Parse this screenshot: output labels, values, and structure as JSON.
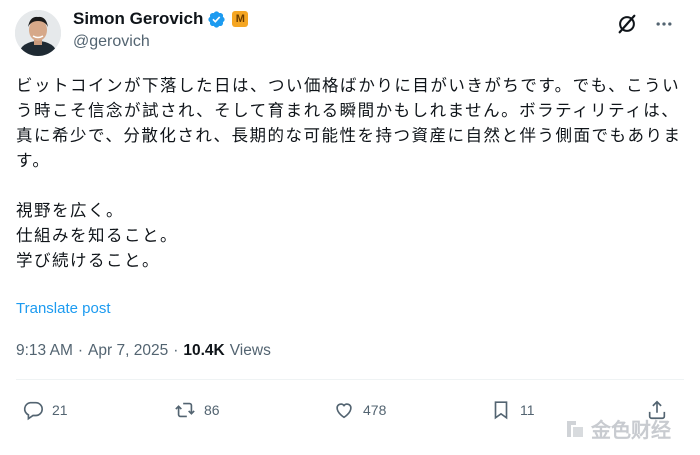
{
  "author": {
    "name": "Simon Gerovich",
    "handle": "@gerovich",
    "badge_text": "M"
  },
  "post": {
    "text": "ビットコインが下落した日は、つい価格ばかりに目がいきがちです。でも、こういう時こそ信念が試され、そして育まれる瞬間かもしれません。ボラティリティは、真に希少で、分散化され、長期的な可能性を持つ資産に自然と伴う側面でもあります。\n\n視野を広く。\n仕組みを知ること。\n学び続けること。",
    "translate_label": "Translate post",
    "time": "9:13 AM",
    "separator": "·",
    "date": "Apr 7, 2025",
    "views_count": "10.4K",
    "views_label": "Views"
  },
  "actions": {
    "replies": "21",
    "reposts": "86",
    "likes": "478",
    "bookmarks": "11"
  },
  "watermark": {
    "text": "金色财经"
  },
  "colors": {
    "accent": "#1d9bf0",
    "secondary_text": "#536471",
    "badge": "#f5a623"
  },
  "icons": [
    "grok-icon",
    "more-icon",
    "verified-icon",
    "reply-icon",
    "repost-icon",
    "like-icon",
    "bookmark-icon",
    "share-icon"
  ]
}
